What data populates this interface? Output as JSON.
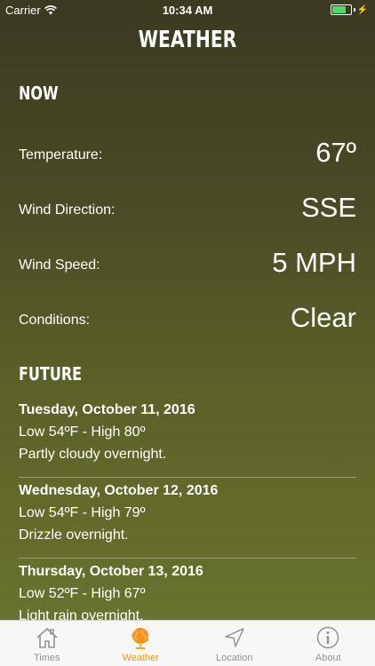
{
  "status_bar": {
    "carrier": "Carrier",
    "time": "10:34 AM",
    "battery_bolt": "⚡",
    "icons": [
      "wifi-icon",
      "battery-icon"
    ]
  },
  "header": {
    "title": "WEATHER"
  },
  "now": {
    "heading": "NOW",
    "rows": [
      {
        "label": "Temperature:",
        "value": "67º"
      },
      {
        "label": "Wind Direction:",
        "value": "SSE"
      },
      {
        "label": "Wind Speed:",
        "value": "5 MPH"
      },
      {
        "label": "Conditions:",
        "value": "Clear"
      }
    ]
  },
  "future": {
    "heading": "FUTURE",
    "items": [
      {
        "date": "Tuesday, October 11, 2016",
        "temps": "Low 54ºF - High 80º",
        "desc": "Partly cloudy overnight."
      },
      {
        "date": "Wednesday, October 12, 2016",
        "temps": "Low 54ºF - High 79º",
        "desc": "Drizzle overnight."
      },
      {
        "date": "Thursday, October 13, 2016",
        "temps": "Low 52ºF - High 67º",
        "desc": "Light rain overnight."
      }
    ]
  },
  "tab_bar": {
    "active": "Weather",
    "active_color": "#f7931e",
    "inactive_color": "#929292",
    "tabs": [
      {
        "label": "Times",
        "icon": "home-icon"
      },
      {
        "label": "Weather",
        "icon": "globe-icon"
      },
      {
        "label": "Location",
        "icon": "location-arrow-icon"
      },
      {
        "label": "About",
        "icon": "info-icon"
      }
    ]
  }
}
